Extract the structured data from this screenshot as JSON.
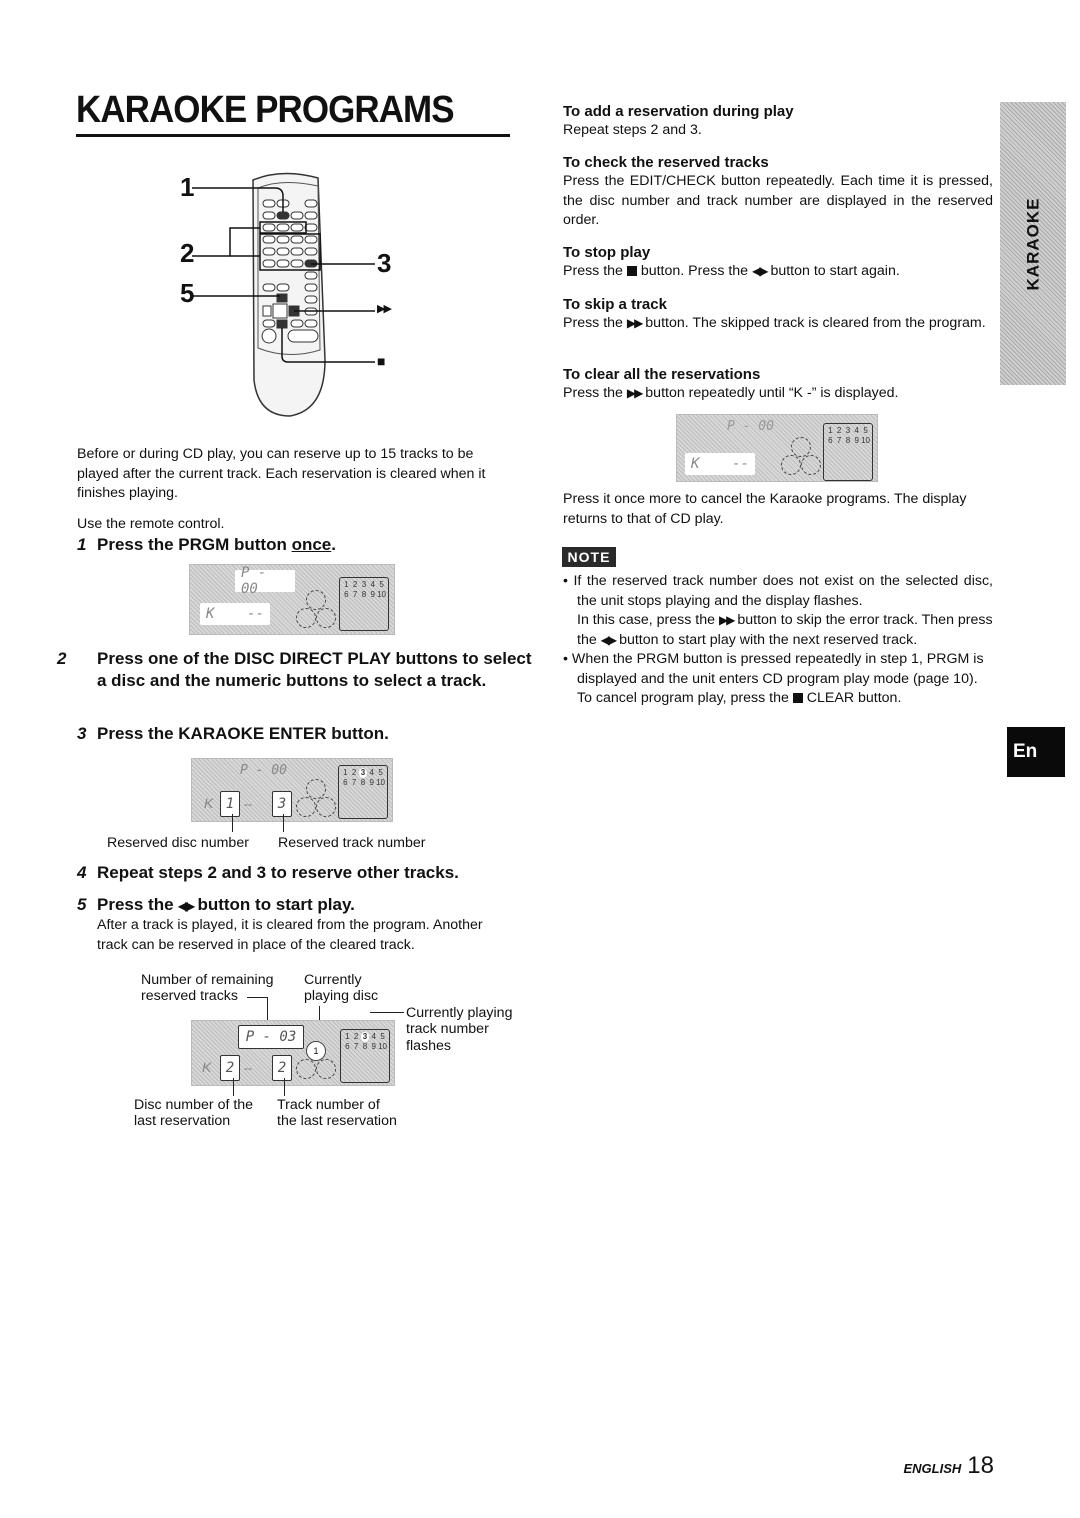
{
  "page": {
    "title": "KARAOKE PROGRAMS",
    "side_tab": "KARAOKE",
    "language_tab": "En",
    "footer_language": "ENGLISH",
    "page_number": "18"
  },
  "remote_diagram": {
    "callouts": [
      "1",
      "2",
      "5",
      "3",
      "▶▶",
      "■"
    ]
  },
  "intro": {
    "paragraph": "Before or during CD play, you can reserve up to 15 tracks to be played after the current track.  Each reservation is cleared when it finishes playing.",
    "use_remote": "Use the remote control."
  },
  "steps": [
    {
      "num": "1",
      "text_before": "Press the PRGM button ",
      "text_underlined": "once",
      "text_after": "."
    },
    {
      "num": "2",
      "text": "Press one of the DISC DIRECT PLAY buttons to select a disc and the numeric buttons to select a track."
    },
    {
      "num": "3",
      "text": "Press the KARAOKE ENTER button."
    },
    {
      "num": "4",
      "text": "Repeat steps 2 and 3 to reserve other tracks."
    },
    {
      "num": "5",
      "text_before": "Press the ",
      "symbol": "◀▶",
      "text_after": " button to start play.",
      "detail": "After a track is played, it is cleared from the program.  Another track can be reserved in place of the cleared track."
    }
  ],
  "displays": {
    "step1": {
      "top": "P - 00",
      "bottom_left": "K",
      "bottom_right": "--",
      "tracks": [
        "1",
        "2",
        "3",
        "4",
        "5",
        "6",
        "7",
        "8",
        "9",
        "10"
      ]
    },
    "step3": {
      "top": "P - 00",
      "bottom_left": "K",
      "disc": "1",
      "track": "3",
      "tracks": [
        "1",
        "2",
        "3",
        "4",
        "5",
        "6",
        "7",
        "8",
        "9",
        "10"
      ],
      "highlight": "3",
      "labels": {
        "disc": "Reserved disc number",
        "track": "Reserved track number"
      }
    },
    "step5": {
      "top": "P - 03",
      "bottom_left": "K",
      "disc": "2",
      "track": "2",
      "playing_disc": "1",
      "tracks": [
        "1",
        "2",
        "3",
        "4",
        "5",
        "6",
        "7",
        "8",
        "9",
        "10"
      ],
      "highlight": "3",
      "labels": {
        "remaining_1": "Number of remaining",
        "remaining_2": "reserved tracks",
        "playing_disc_1": "Currently",
        "playing_disc_2": "playing disc",
        "flash_1": "Currently playing",
        "flash_2": "track number",
        "flash_3": "flashes",
        "disc_last_1": "Disc number of the",
        "disc_last_2": "last reservation",
        "track_last_1": "Track number of",
        "track_last_2": "the last reservation"
      }
    },
    "clear": {
      "top": "P - 00",
      "bottom_left": "K",
      "bottom_right": "--",
      "tracks": [
        "1",
        "2",
        "3",
        "4",
        "5",
        "6",
        "7",
        "8",
        "9",
        "10"
      ]
    }
  },
  "sections": [
    {
      "heading": "To add a reservation during play",
      "body": "Repeat steps 2 and 3."
    },
    {
      "heading": "To check the reserved tracks",
      "body": "Press the EDIT/CHECK button repeatedly.  Each time it is pressed, the disc number and track number are displayed in the reserved order."
    },
    {
      "heading": "To stop play",
      "body_1": "Press the ",
      "body_2": " button.  Press the ",
      "symbol": "◀▶",
      "body_3": " button to start again."
    },
    {
      "heading": "To skip a track",
      "body_1": "Press the ",
      "symbol": "▶▶",
      "body_2": " button.  The skipped track is cleared from the program."
    },
    {
      "heading": "To clear all the reservations",
      "body_1": "Press the ",
      "symbol": "▶▶",
      "body_2": " button repeatedly until “K -”  is displayed."
    }
  ],
  "after_clear": "Press it once more to cancel the Karaoke programs. The display returns to that of CD play.",
  "note": {
    "badge": "NOTE",
    "b1_line1": "If the reserved track number does not exist on the selected disc, the unit stops playing and the display flashes.",
    "b1_line2a": "In this case, press the ",
    "b1_sym1": "▶▶",
    "b1_line2b": " button to skip the error track. Then press the ",
    "b1_sym2": "◀▶",
    "b1_line2c": " button to start play with the next reserved track.",
    "b2_line1": "When the PRGM button is pressed repeatedly in step 1, PRGM is displayed and the unit enters CD program play mode (page 10).",
    "b2_line2a": "To cancel program play, press the ",
    "b2_line2b": " CLEAR button."
  }
}
